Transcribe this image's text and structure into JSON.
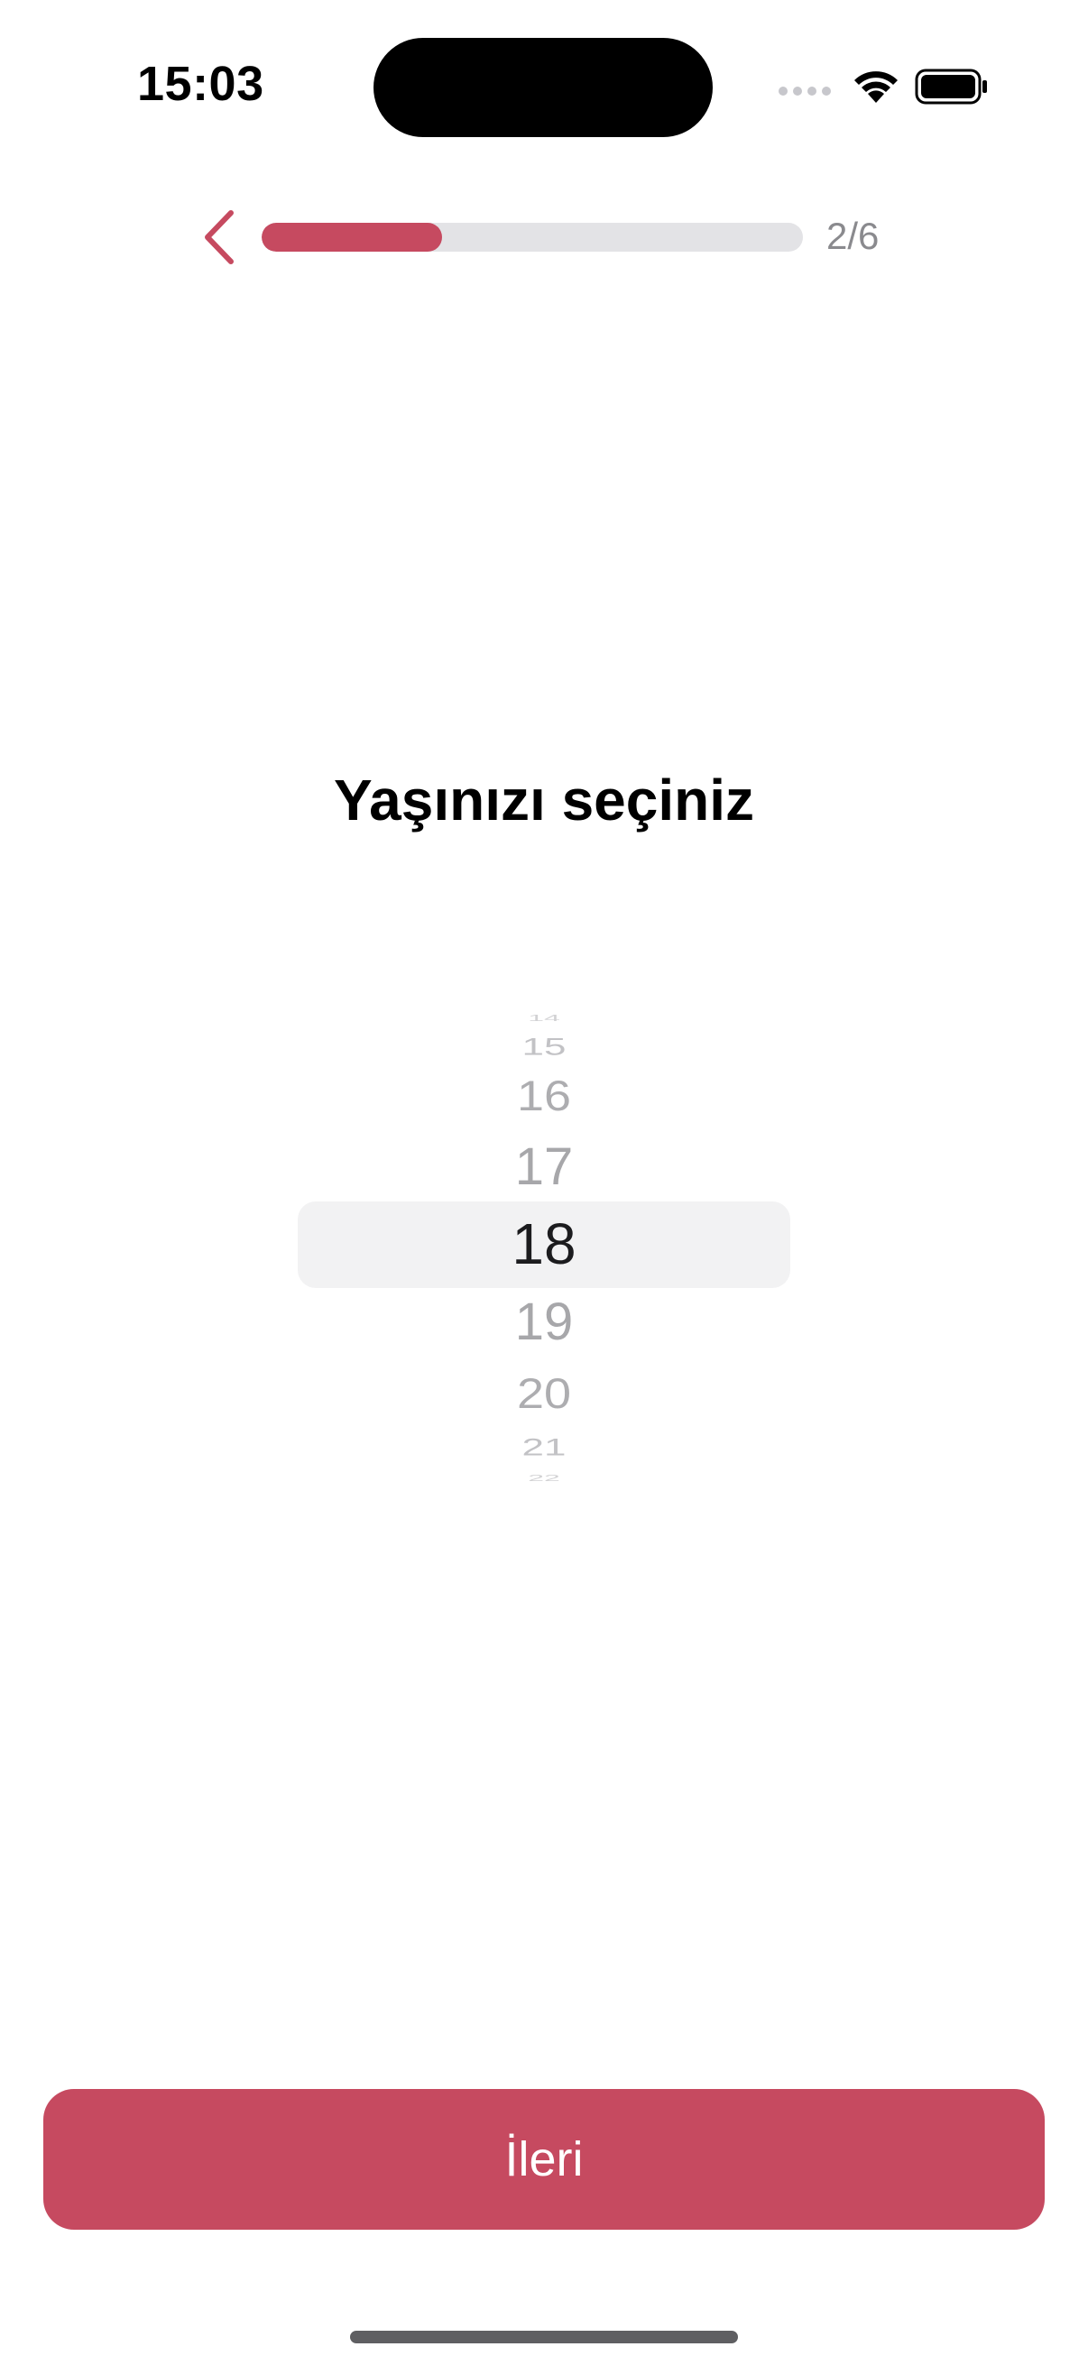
{
  "status_bar": {
    "time": "15:03",
    "icons": [
      "signal-dots-icon",
      "wifi-icon",
      "battery-icon"
    ]
  },
  "header": {
    "back_icon": "chevron-left-icon",
    "progress_step": "2/6",
    "progress_fraction": 0.333,
    "accent_color": "#c64a60"
  },
  "main": {
    "title": "Yaşınızı seçiniz",
    "picker": {
      "visible_values": [
        "14",
        "15",
        "16",
        "17",
        "18",
        "19",
        "20",
        "21",
        "22"
      ],
      "selected": "18"
    }
  },
  "footer": {
    "next_label": "İleri"
  }
}
